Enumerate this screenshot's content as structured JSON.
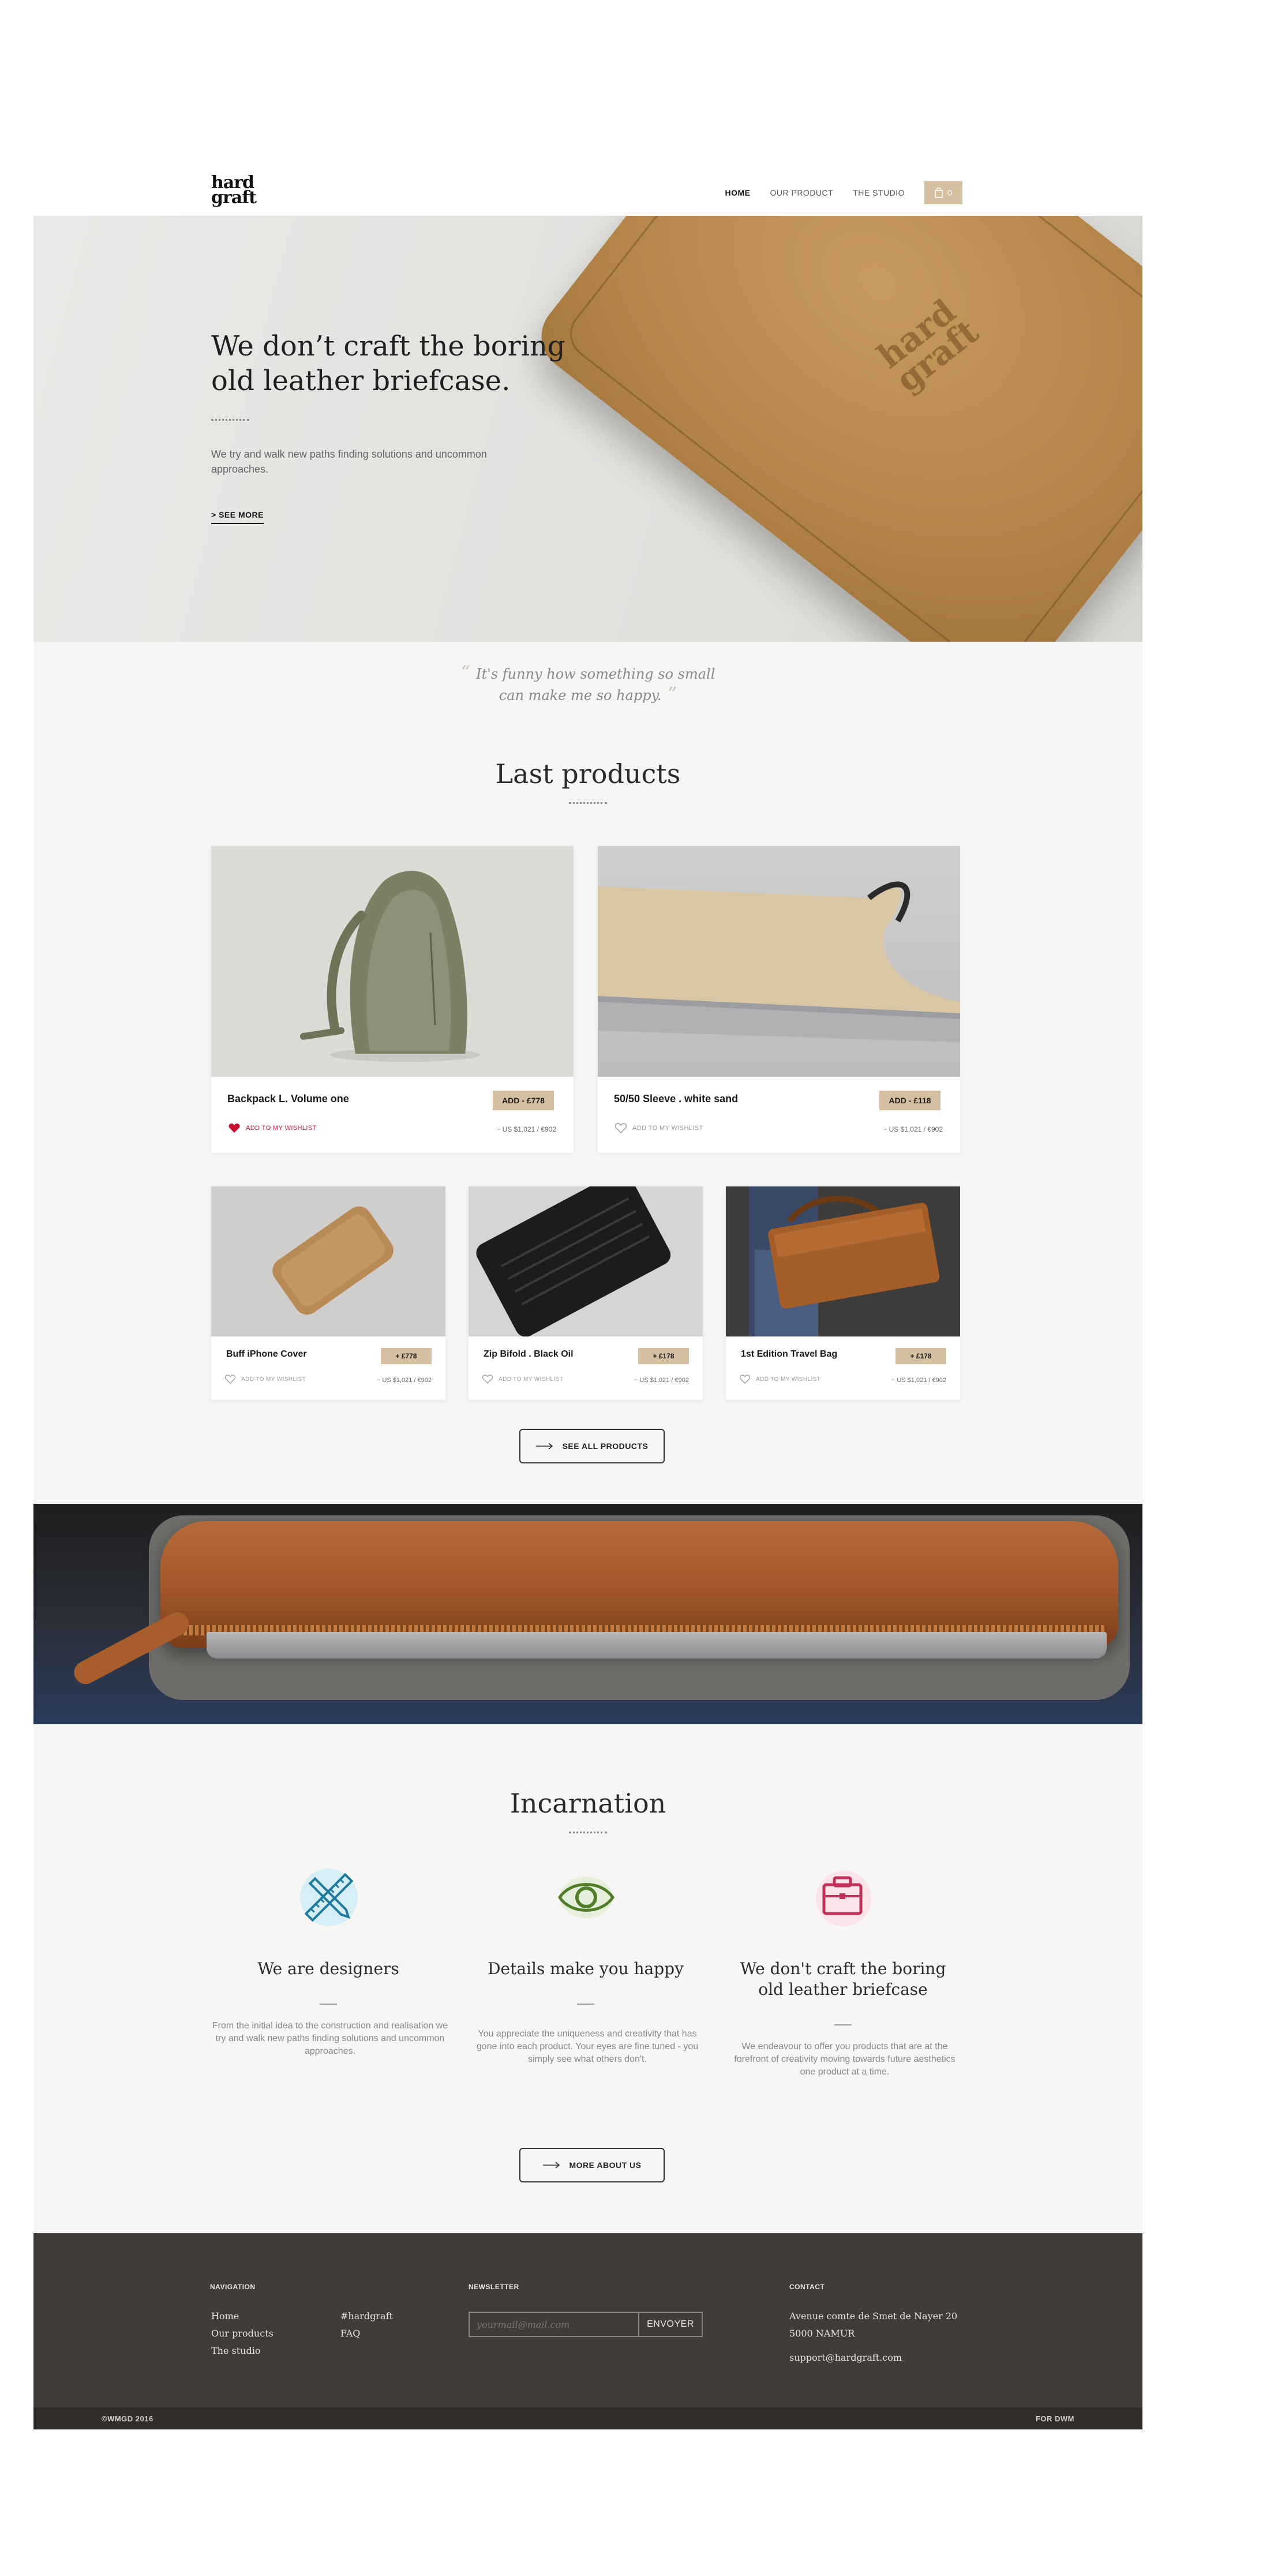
{
  "header": {
    "logo_line1": "hard",
    "logo_line2": "graft",
    "nav": [
      "HOME",
      "OUR PRODUCT",
      "THE STUDIO"
    ],
    "cart_count": "0"
  },
  "hero": {
    "title": "We don’t craft the boring old leather briefcase.",
    "text": "We try and walk new paths finding solutions and uncommon approaches.",
    "cta": "> SEE MORE",
    "emboss_line1": "hard",
    "emboss_line2": "graft"
  },
  "quote": {
    "line1": "It's funny how something so small",
    "line2": "can make me so happy."
  },
  "products": {
    "title": "Last products",
    "featured": [
      {
        "name": "Backpack L. Volume one",
        "add": "ADD - £778",
        "wishlist": "ADD TO MY WISHLIST",
        "price": "~ US $1,021 / €902",
        "wish_active": true
      },
      {
        "name": "50/50 Sleeve . white sand",
        "add": "ADD - £118",
        "wishlist": "ADD TO MY WISHLIST",
        "price": "~ US $1,021 / €902",
        "wish_active": false
      }
    ],
    "small": [
      {
        "name": "Buff iPhone Cover",
        "add": "+ £778",
        "wishlist": "ADD TO MY WISHLIST",
        "price": "~ US $1,021 / €902"
      },
      {
        "name": "Zip Bifold . Black Oil",
        "add": "+ £178",
        "wishlist": "ADD TO MY WISHLIST",
        "price": "~ US $1,021 / €902"
      },
      {
        "name": "1st Edition Travel Bag",
        "add": "+ £178",
        "wishlist": "ADD TO MY WISHLIST",
        "price": "~ US $1,021 / €902"
      }
    ],
    "see_all": "SEE ALL PRODUCTS"
  },
  "incarnation": {
    "title": "Incarnation",
    "features": [
      {
        "title": "We are designers",
        "text": "From the initial idea to the construction and realisation we try and walk new paths finding solutions and uncommon approaches.",
        "icon": "tools-icon",
        "color": "#1f7aa0"
      },
      {
        "title": "Details make you happy",
        "text": "You appreciate the uniqueness and creativity that has gone into each product. Your eyes are fine tuned - you simply see what others don't.",
        "icon": "eye-icon",
        "color": "#4f7d28"
      },
      {
        "title": "We don't craft the boring old leather briefcase",
        "text": "We endeavour to offer you products that are at the forefront of creativity moving towards future aesthetics one product at a time.",
        "icon": "briefcase-icon",
        "color": "#c0305a"
      }
    ],
    "more": "MORE ABOUT US"
  },
  "footer": {
    "nav_head": "NAVIGATION",
    "nav_links": [
      "Home",
      "Our products",
      "The studio"
    ],
    "nav_links2": [
      "#hardgraft",
      "FAQ"
    ],
    "newsletter_head": "NEWSLETTER",
    "newsletter_placeholder": "yourmail@mail.com",
    "newsletter_button": "ENVOYER",
    "contact_head": "CONTACT",
    "address_line1": "Avenue comte de Smet de Nayer 20",
    "address_line2": "5000 NAMUR",
    "email": "support@hardgraft.com",
    "copyright": "©WMGD 2016",
    "credit": "FOR DWM"
  },
  "colors": {
    "accent": "#d4bfa0",
    "footer": "#413c39",
    "wishlist_active": "#c8102e"
  }
}
